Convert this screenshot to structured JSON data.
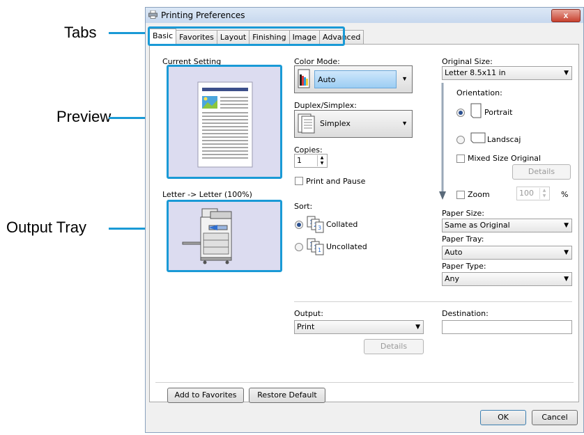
{
  "callouts": {
    "tabs": "Tabs",
    "preview": "Preview",
    "output_tray": "Output Tray"
  },
  "window": {
    "title": "Printing Preferences",
    "close": "x"
  },
  "tabs": [
    "Basic",
    "Favorites",
    "Layout",
    "Finishing",
    "Image",
    "Advanced"
  ],
  "left": {
    "current_setting": "Current Setting",
    "scale_text": "Letter -> Letter (100%)"
  },
  "color_mode": {
    "label": "Color Mode:",
    "value": "Auto"
  },
  "duplex": {
    "label": "Duplex/Simplex:",
    "value": "Simplex"
  },
  "copies": {
    "label": "Copies:",
    "value": "1"
  },
  "print_pause": "Print and Pause",
  "sort": {
    "label": "Sort:",
    "collated": "Collated",
    "uncollated": "Uncollated"
  },
  "original_size": {
    "label": "Original Size:",
    "value": "Letter 8.5x11 in"
  },
  "orientation": {
    "label": "Orientation:",
    "portrait": "Portrait",
    "landscape": "Landscaj"
  },
  "mixed_size": "Mixed Size Original",
  "details_button": "Details",
  "zoom": {
    "label": "Zoom",
    "value": "100",
    "unit": "%"
  },
  "paper_size": {
    "label": "Paper Size:",
    "value": "Same as Original"
  },
  "paper_tray": {
    "label": "Paper Tray:",
    "value": "Auto"
  },
  "paper_type": {
    "label": "Paper Type:",
    "value": "Any"
  },
  "output": {
    "label": "Output:",
    "value": "Print",
    "details": "Details"
  },
  "destination": {
    "label": "Destination:",
    "value": ""
  },
  "footer": {
    "add_favorites": "Add to Favorites",
    "restore": "Restore Default",
    "ok": "OK",
    "cancel": "Cancel"
  },
  "colors": {
    "accent": "#1a9ad6",
    "preview_bg": "#dcdcf0",
    "doc_header": "#3c4f8a"
  }
}
